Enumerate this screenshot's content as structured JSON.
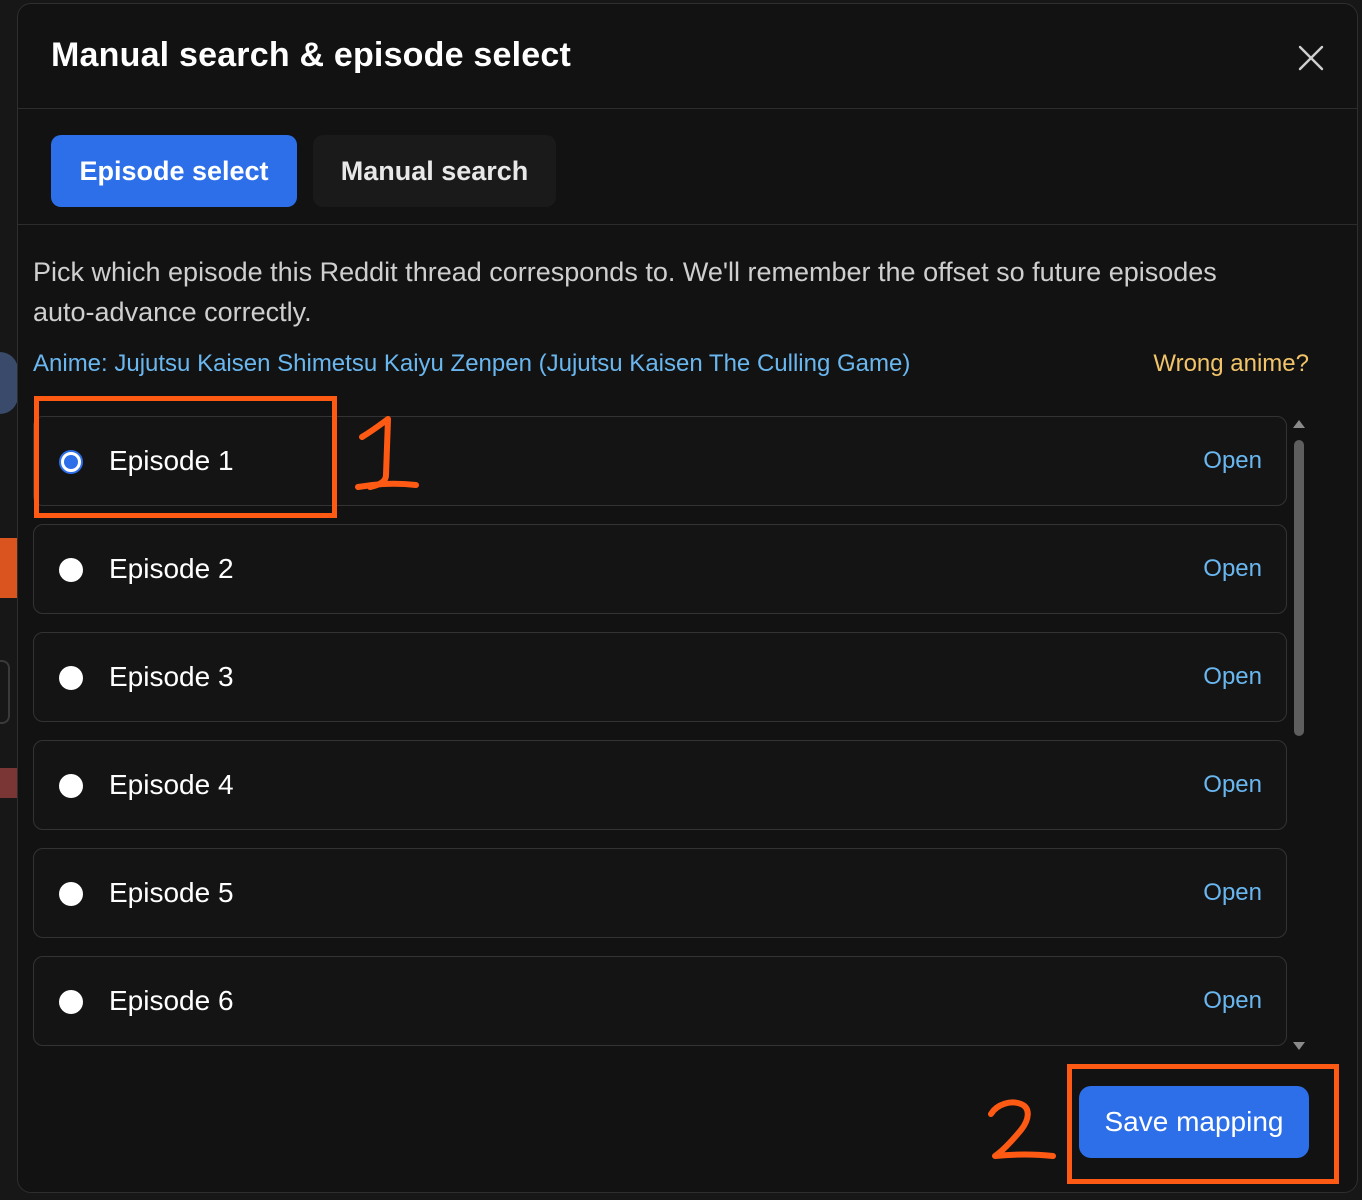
{
  "modal": {
    "title": "Manual search & episode select",
    "close_icon": "close-icon"
  },
  "tabs": [
    {
      "label": "Episode select",
      "active": true
    },
    {
      "label": "Manual search",
      "active": false
    }
  ],
  "description": "Pick which episode this Reddit thread corresponds to. We'll remember the offset so future episodes auto-advance correctly.",
  "anime": {
    "label": "Anime: Jujutsu Kaisen Shimetsu Kaiyu Zenpen (Jujutsu Kaisen The Culling Game)",
    "wrong_link": "Wrong anime?"
  },
  "episodes": [
    {
      "label": "Episode 1",
      "open": "Open",
      "selected": true
    },
    {
      "label": "Episode 2",
      "open": "Open",
      "selected": false
    },
    {
      "label": "Episode 3",
      "open": "Open",
      "selected": false
    },
    {
      "label": "Episode 4",
      "open": "Open",
      "selected": false
    },
    {
      "label": "Episode 5",
      "open": "Open",
      "selected": false
    },
    {
      "label": "Episode 6",
      "open": "Open",
      "selected": false
    }
  ],
  "save_button": "Save mapping",
  "annotations": [
    "1",
    "2"
  ],
  "colors": {
    "accent": "#2d6fe8",
    "link": "#6ab7f0",
    "warning": "#f2c46a",
    "annotation": "#ff5a14"
  }
}
